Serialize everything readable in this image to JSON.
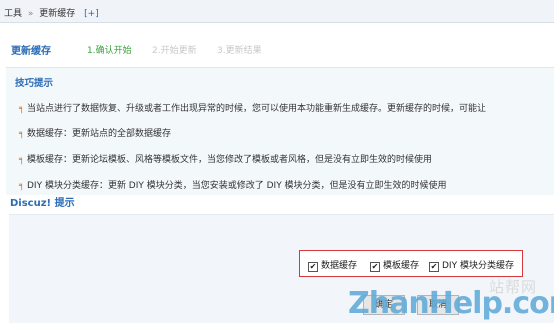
{
  "breadcrumb": {
    "root": "工具",
    "separator": "»",
    "current": "更新缓存",
    "add": "[+]"
  },
  "page": {
    "title": "更新缓存",
    "steps": [
      "1.确认开始",
      "2.开始更新",
      "3.更新结果"
    ]
  },
  "tips": {
    "title": "技巧提示",
    "bullet": "╕",
    "items": [
      "当站点进行了数据恢复、升级或者工作出现异常的时候，您可以使用本功能重新生成缓存。更新缓存的时候，可能让",
      "数据缓存：更新站点的全部数据缓存",
      "模板缓存：更新论坛模板、风格等模板文件，当您修改了模板或者风格，但是没有立即生效的时候使用",
      "DIY 模块分类缓存：更新 DIY 模块分类，当您安装或修改了 DIY 模块分类，但是没有立即生效的时候使用"
    ]
  },
  "footer_title": "Discuz! 提示",
  "options": [
    {
      "label": "数据缓存",
      "checked": true
    },
    {
      "label": "模板缓存",
      "checked": true
    },
    {
      "label": "DIY 模块分类缓存",
      "checked": true
    }
  ],
  "buttons": {
    "confirm": "确定",
    "cancel": "取消"
  },
  "watermark": {
    "cn": "站帮网",
    "logo": "ZhanHelp.com"
  },
  "colors": {
    "link_blue": "#2b6cb5",
    "step_active": "#3aa33a",
    "step_inactive": "#c8c8c8",
    "highlight_border": "#d43a3a"
  }
}
